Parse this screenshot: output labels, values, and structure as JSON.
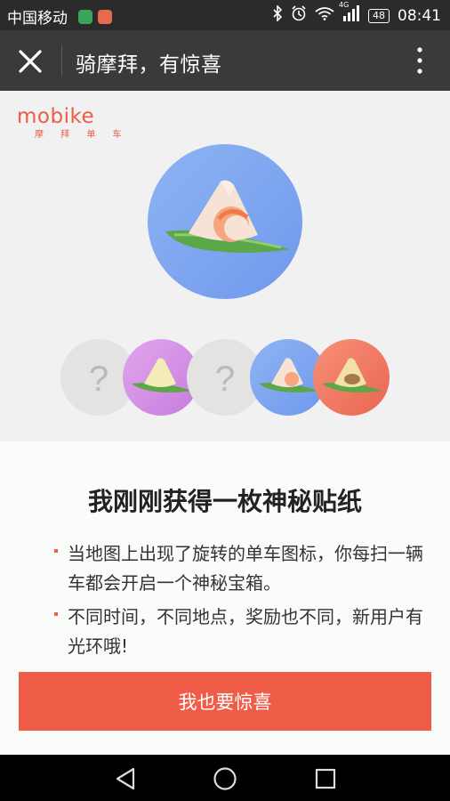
{
  "status_bar": {
    "carrier": "中国移动",
    "network": "4G",
    "battery": "48",
    "time": "08:41",
    "icons": [
      "wechat-notification-icon",
      "app-notification-icon",
      "bluetooth-icon",
      "alarm-icon",
      "wifi-icon",
      "signal-icon",
      "battery-icon"
    ]
  },
  "header": {
    "title": "骑摩拜，有惊喜",
    "icons": [
      "close-icon",
      "more-vertical-icon"
    ]
  },
  "brand": {
    "name": "mobike",
    "sub": "摩 拜 单 车",
    "color": "#e95d4a"
  },
  "stickers": {
    "placeholder_text": "?",
    "items": [
      "zongzi-shrimp-blue",
      "unknown",
      "zongzi-purple",
      "unknown",
      "zongzi-shrimp-blue",
      "zongzi-mushroom-red"
    ]
  },
  "main": {
    "headline": "我刚刚获得一枚神秘贴纸",
    "tips": [
      "当地图上出现了旋转的单车图标，你每扫一辆车都会开启一个神秘宝箱。",
      "不同时间，不同地点，奖励也不同，新用户有光环哦!"
    ],
    "button": "我也要惊喜"
  },
  "colors": {
    "accent": "#ef5d48",
    "topbar": "#3a3a3a",
    "status": "#2b2b2b"
  }
}
